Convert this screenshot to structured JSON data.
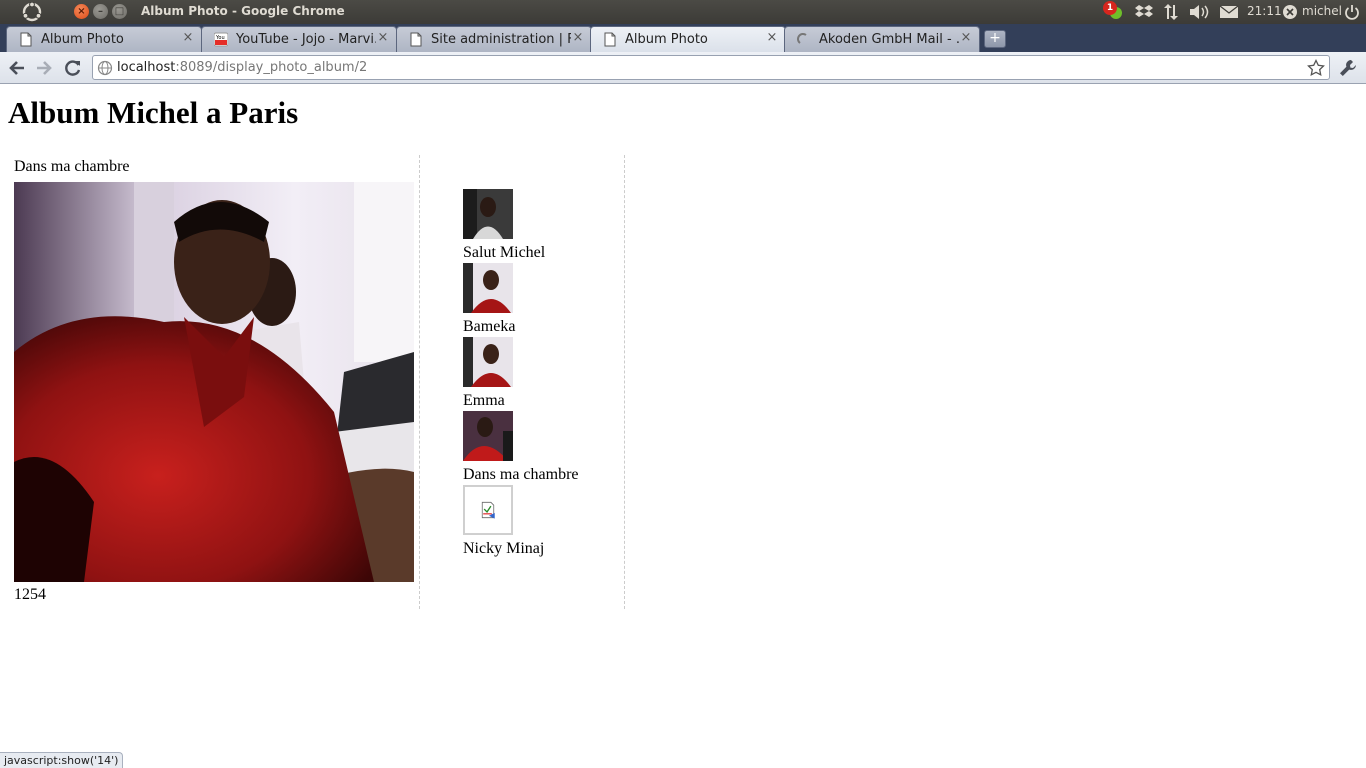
{
  "window": {
    "title": "Album Photo - Google Chrome"
  },
  "system_panel": {
    "notification_count": "1",
    "clock": "21:11",
    "user": "michel"
  },
  "tabs": [
    {
      "title": "Album Photo",
      "favicon": "page-icon",
      "active": false
    },
    {
      "title": "YouTube - Jojo - Marvi…",
      "favicon": "youtube-icon",
      "active": false
    },
    {
      "title": "Site administration | Fi…",
      "favicon": "page-icon",
      "active": false
    },
    {
      "title": "Album Photo",
      "favicon": "page-icon",
      "active": true
    },
    {
      "title": "Akoden GmbH Mail - …",
      "favicon": "loading-icon",
      "active": false
    }
  ],
  "omnibox": {
    "host": "localhost",
    "rest": ":8089/display_photo_album/2"
  },
  "page": {
    "title": "Album Michel a Paris",
    "main_photo": {
      "caption": "Dans ma chambre",
      "id": "1254"
    },
    "thumbnails": [
      {
        "caption": "Salut Michel"
      },
      {
        "caption": "Bameka"
      },
      {
        "caption": "Emma"
      },
      {
        "caption": "Dans ma chambre"
      },
      {
        "caption": "Nicky Minaj"
      }
    ]
  },
  "status_bar": {
    "text": "javascript:show('14')"
  },
  "colors": {
    "tab_strip": "#333f59",
    "close_button": "#df4a16",
    "panel": "#3c3b37"
  }
}
